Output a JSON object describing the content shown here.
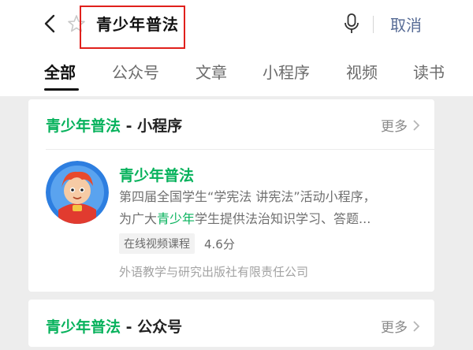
{
  "search": {
    "query": "青少年普法",
    "cancel_label": "取消"
  },
  "tabs": [
    {
      "label": "全部",
      "active": true
    },
    {
      "label": "公众号"
    },
    {
      "label": "文章"
    },
    {
      "label": "小程序"
    },
    {
      "label": "视频"
    },
    {
      "label": "读书"
    }
  ],
  "miniprogram_section": {
    "title_highlight": "青少年普法",
    "title_suffix": " - 小程序",
    "more_label": "更多",
    "item": {
      "name": "青少年普法",
      "desc_line1": "第四届全国学生“学宪法 讲宪法”活动小程序，",
      "desc_line2_prefix": "为广大",
      "desc_line2_highlight": "青少年",
      "desc_line2_suffix": "学生提供法治知识学习、答题...",
      "tag": "在线视频课程",
      "rating": "4.6分",
      "publisher": "外语教学与研究出版社有限责任公司"
    }
  },
  "account_section": {
    "title_highlight": "青少年普法",
    "title_suffix": " - 公众号",
    "more_label": "更多"
  },
  "colors": {
    "accent_green": "#07b25c",
    "link_blue": "#576b95",
    "highlight_red": "#e0201c"
  }
}
